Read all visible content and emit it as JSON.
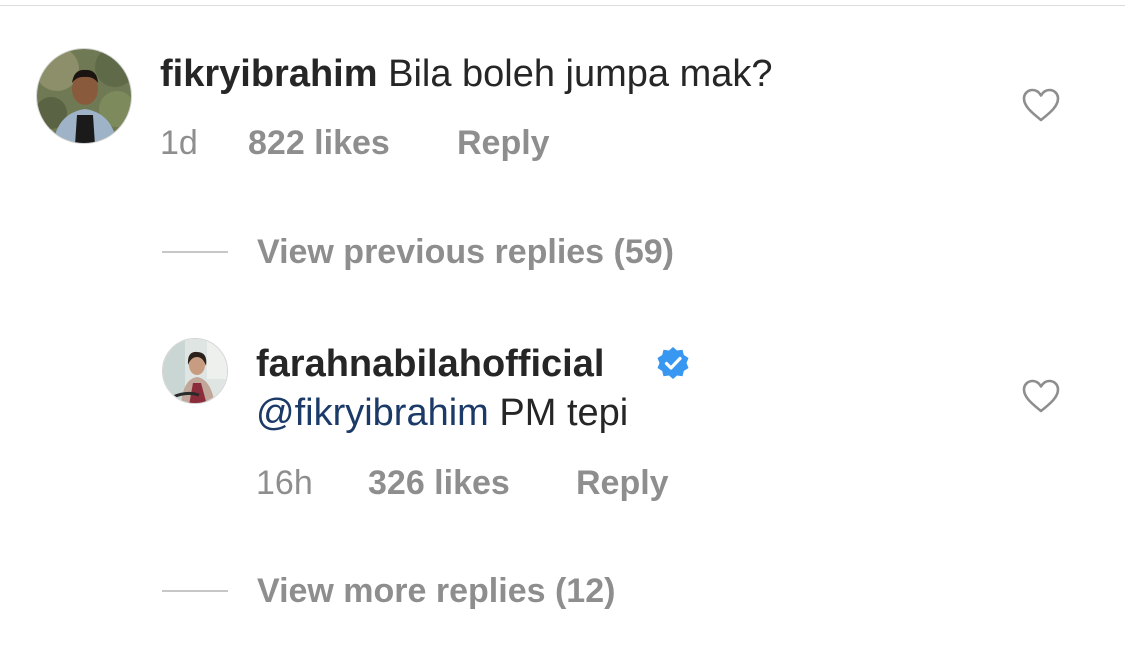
{
  "comment": {
    "username": "fikryibrahim",
    "text": "Bila boleh jumpa mak?",
    "time": "1d",
    "likes": "822 likes",
    "reply_label": "Reply"
  },
  "view_previous": "View previous replies (59)",
  "reply": {
    "username": "farahnabilahofficial",
    "mention": "@fikryibrahim",
    "text": "PM tepi",
    "time": "16h",
    "likes": "326 likes",
    "reply_label": "Reply"
  },
  "view_more": "View more replies (12)",
  "icons": {
    "like": "heart-outline-icon",
    "verified": "verified-badge-icon"
  },
  "colors": {
    "text": "#262626",
    "muted": "#8e8e8e",
    "mention": "#1b3a67",
    "verified": "#3897f0"
  }
}
